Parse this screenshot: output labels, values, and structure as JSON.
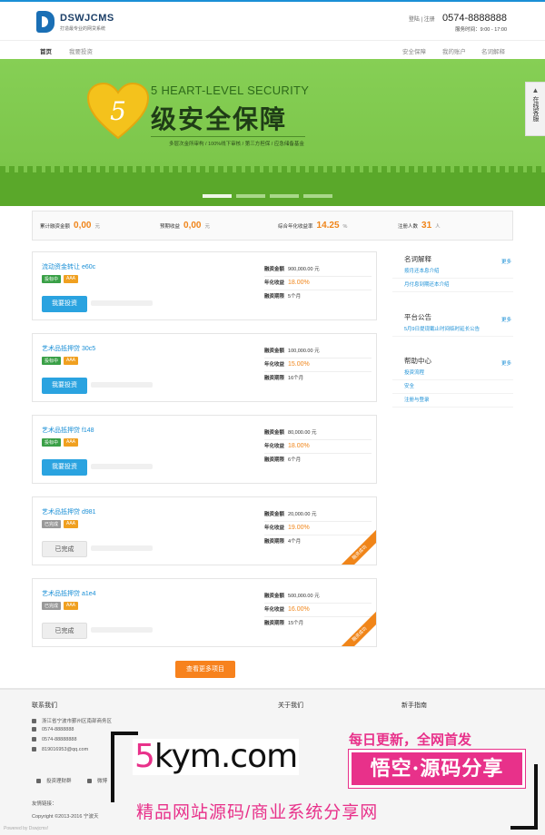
{
  "header": {
    "logo_name": "DSWJCMS",
    "logo_sub": "打造最专业的网贷系统",
    "login_links": "登陆 | 注册",
    "phone": "0574-8888888",
    "hours": "服务时间：9:00 - 17:00"
  },
  "nav": {
    "home": "首页",
    "invest": "我要投资",
    "security": "安全保障",
    "account": "我的账户",
    "glossary": "名词解释"
  },
  "banner": {
    "english": "5 HEART-LEVEL SECURITY",
    "chinese": "级安全保障",
    "heart_digit": "5",
    "subtitle": "多层次金所审构 / 100%线下审核 / 第三方担保 / 应急储备基金",
    "slides": 4,
    "active_slide": 0
  },
  "float_service": {
    "label": "在线客服"
  },
  "stats": [
    {
      "label": "累计融资金额",
      "value": "0,00",
      "unit": "元"
    },
    {
      "label": "预期收益",
      "value": "0,00",
      "unit": "元"
    },
    {
      "label": "综合年化收益率",
      "value": "14.25",
      "unit": "%"
    },
    {
      "label": "注册人数",
      "value": "31",
      "unit": "人"
    }
  ],
  "projects": [
    {
      "title": "流动资金转让 e60c",
      "tag1": "投标中",
      "tag2": "AAA",
      "button": "我要投资",
      "amount_label": "融资金额",
      "amount": "900,000.00 元",
      "rate_label": "年化收益",
      "rate": "18.00%",
      "term_label": "融资期限",
      "term": "5个月",
      "done": false
    },
    {
      "title": "艺术品抵押贷 30c5",
      "tag1": "投标中",
      "tag2": "AAA",
      "button": "我要投资",
      "amount_label": "融资金额",
      "amount": "100,000.00 元",
      "rate_label": "年化收益",
      "rate": "15.00%",
      "term_label": "融资期限",
      "term": "16个月",
      "done": false
    },
    {
      "title": "艺术品抵押贷 f148",
      "tag1": "投标中",
      "tag2": "AAA",
      "button": "我要投资",
      "amount_label": "融资金额",
      "amount": "80,000.00 元",
      "rate_label": "年化收益",
      "rate": "18.00%",
      "term_label": "融资期限",
      "term": "6个月",
      "done": false
    },
    {
      "title": "艺术品抵押贷 d981",
      "tag1": "已完成",
      "tag2": "AAA",
      "button": "已完成",
      "amount_label": "融资金额",
      "amount": "20,000.00 元",
      "rate_label": "年化收益",
      "rate": "19.00%",
      "term_label": "融资期限",
      "term": "4个月",
      "done": true,
      "ribbon": "融资成功"
    },
    {
      "title": "艺术品抵押贷 a1e4",
      "tag1": "已完成",
      "tag2": "AAA",
      "button": "已完成",
      "amount_label": "融资金额",
      "amount": "500,000.00 元",
      "rate_label": "年化收益",
      "rate": "16.00%",
      "term_label": "融资期限",
      "term": "15个月",
      "done": true,
      "ribbon": "融资成功"
    }
  ],
  "sidebar": {
    "glossary": {
      "title": "名词解释",
      "more": "更多",
      "items": [
        "按月还本息介绍",
        "月付息到期还本介绍"
      ]
    },
    "notice": {
      "title": "平台公告",
      "more": "更多",
      "items": [
        "5月9日提现截止时间临时延长公告"
      ]
    },
    "help": {
      "title": "帮助中心",
      "more": "更多",
      "items": [
        "投资流程",
        "安全",
        "注册与登录"
      ]
    }
  },
  "more_button": "查看更多项目",
  "footer": {
    "contact_title": "联系我们",
    "address": "浙江省宁波市鄞州区南部商务区",
    "phone1": "0574-8888888",
    "phone2": "0574-88888888",
    "email": "819016953@qq.com",
    "about_title": "关于我们",
    "guide_title": "新手指南",
    "wechat": "投资理财群",
    "weibo": "微博",
    "links_label": "友情链接：",
    "copyright": "Copyright ©2013-2016 宁波天"
  },
  "watermark": {
    "site_prefix": "5",
    "site_rest": "kym.com",
    "daily": "每日更新，全网首发",
    "box_text": "悟空·源码分享",
    "tagline": "精品网站源码/商业系统分享网"
  },
  "powered": "Powered by Dswjcms!",
  "colors": {
    "accent_blue": "#1a8fd6",
    "accent_orange": "#f08519",
    "banner_green": "#7cc64a",
    "watermark_pink": "#e8318a"
  }
}
